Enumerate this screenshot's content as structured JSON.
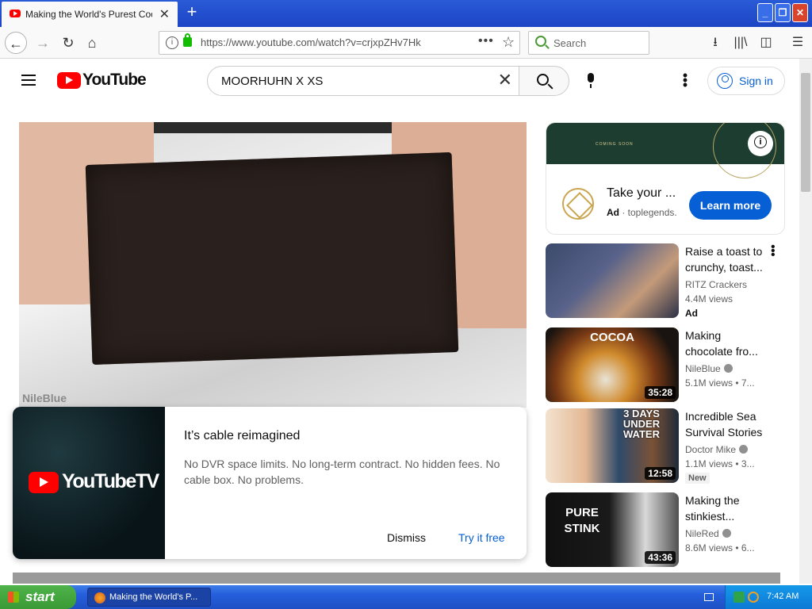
{
  "browser": {
    "tab_title": "Making the World's Purest Cookie",
    "url": "https://www.youtube.com/watch?v=crjxpZHv7Hk",
    "search_placeholder": "Search"
  },
  "youtube": {
    "logo_text": "YouTube",
    "search_query": "MOORHUHN X XS",
    "signin_label": "Sign in"
  },
  "video": {
    "watermark": "NileBlue"
  },
  "popup": {
    "logo_text": "YouTubeTV",
    "title": "It’s cable reimagined",
    "body": "No DVR space limits. No long-term contract. No hidden fees. No cable box. No problems.",
    "dismiss_label": "Dismiss",
    "try_label": "Try it free"
  },
  "ad": {
    "banner_text": "COMING SOON",
    "headline": "Take your ...",
    "ad_label": "Ad",
    "advertiser": "toplegends.",
    "cta": "Learn more"
  },
  "recommendations": [
    {
      "title_line1": "Raise a toast to",
      "title_line2": "crunchy, toast...",
      "channel": "RITZ Crackers",
      "views": "4.4M views",
      "tag": "Ad"
    },
    {
      "title_line1": "Making",
      "title_line2": "chocolate fro...",
      "channel": "NileBlue",
      "views": "5.1M views • 7...",
      "duration": "35:28",
      "thumb_text": "COCOA"
    },
    {
      "title_line1": "Incredible Sea",
      "title_line2": "Survival Stories",
      "channel": "Doctor Mike",
      "views": "1.1M views • 3...",
      "duration": "12:58",
      "tag": "New",
      "thumb_text": "3 DAYS UNDER WATER"
    },
    {
      "title_line1": "Making the",
      "title_line2": "stinkiest...",
      "channel": "NileRed",
      "views": "8.6M views • 6...",
      "duration": "43:36",
      "thumb_text": "PURE STINK"
    }
  ],
  "taskbar": {
    "start_label": "start",
    "task_label": "Making the World's P...",
    "clock": "7:42 AM"
  },
  "colors": {
    "youtube_red": "#ff0000",
    "link_blue": "#065fd4",
    "xp_blue": "#245edb",
    "xp_green": "#3a9a35"
  }
}
